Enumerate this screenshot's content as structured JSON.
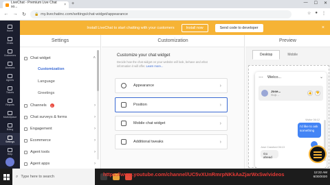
{
  "browser": {
    "tab_title": "LiveChat - Premium Live Chat so...",
    "tab_close": "×",
    "new_tab": "+",
    "window_controls": [
      "—",
      "☐",
      "✕"
    ],
    "url": "my.livechatinc.com/settings/chat-widget/appearance"
  },
  "app_sidebar": {
    "items": [
      {
        "label": "Home",
        "icon": "home-icon"
      },
      {
        "label": "Chats",
        "icon": "chat-icon"
      },
      {
        "label": "Customers",
        "icon": "customers-icon"
      },
      {
        "label": "Archives",
        "icon": "archives-icon"
      },
      {
        "label": "Agents",
        "icon": "agents-icon"
      },
      {
        "label": "Tickets",
        "icon": "tickets-icon"
      },
      {
        "label": "Reports",
        "icon": "reports-icon"
      },
      {
        "label": "Marketplace",
        "icon": "marketplace-icon"
      },
      {
        "label": "Billing",
        "icon": "billing-icon"
      },
      {
        "label": "Settings",
        "icon": "gear-icon"
      },
      {
        "label": "Help",
        "icon": "help-icon"
      }
    ]
  },
  "banner": {
    "text": "Install LiveChat to start chatting with your customers",
    "install_label": "Install now",
    "send_label": "Send code to developer",
    "close": "×"
  },
  "settings": {
    "title": "Settings",
    "chat_widget_label": "Chat widget",
    "sub_items": [
      "Customization",
      "Language",
      "Greetings"
    ],
    "channels_label": "Channels",
    "channels_badge": "1",
    "items": [
      "Chat surveys & forms",
      "Engagement",
      "Ecommerce",
      "Agent tools",
      "Agent apps"
    ]
  },
  "customization": {
    "title": "Customization",
    "heading": "Customize your chat widget",
    "description": "Decide how the chat widget on your website will look, behave and what information it will offer.",
    "learn_more": "Learn more...",
    "cards": [
      "Appearance",
      "Position",
      "Mobile chat widget",
      "Additional tweaks"
    ]
  },
  "preview": {
    "title": "Preview",
    "tabs": [
      "Desktop",
      "Mobile"
    ],
    "welcome": "Welco...",
    "agent_name": "Jose...",
    "agent_role": "Sup...",
    "visitor_stamp": "Visitor 06:12",
    "visitor_message": "I'd like to ask something",
    "agent_stamp": "Jose Crawford 06:13",
    "agent_reply": "Go ahead"
  },
  "taskbar": {
    "search_placeholder": "Type here to search",
    "overlay_link": "https://www.youtube.com/channel/UC5vXUnRmrpNKkAaZjarWxSw/videos",
    "time": "12:22 AM",
    "date": "6/30/2020"
  }
}
